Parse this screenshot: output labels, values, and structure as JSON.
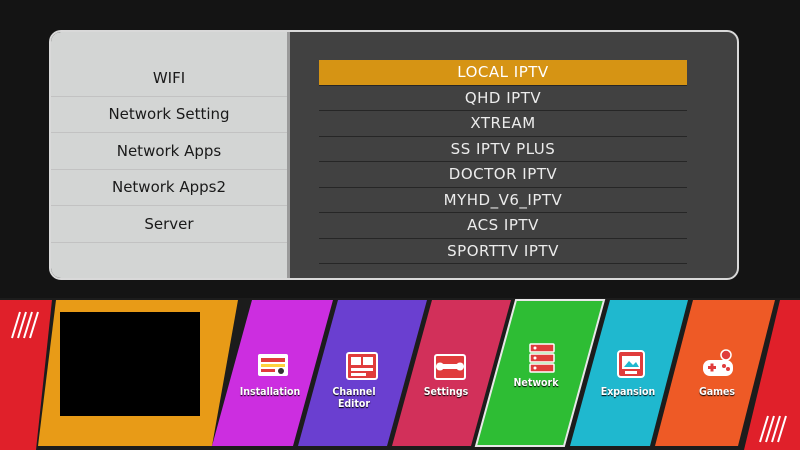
{
  "sidebar": {
    "items": [
      "WIFI",
      "Network Setting",
      "Network Apps",
      "Network Apps2",
      "Server"
    ]
  },
  "iptv_list": {
    "items": [
      "LOCAL IPTV",
      "QHD IPTV",
      "XTREAM",
      "SS IPTV PLUS",
      "DOCTOR IPTV",
      "MYHD_V6_IPTV",
      "ACS IPTV",
      "SPORTTV IPTV"
    ],
    "selected_index": 0
  },
  "taskbar": {
    "items": [
      {
        "label": "Installation",
        "icon": "installation-icon",
        "color": "#cc2ee0"
      },
      {
        "label": "Channel Editor",
        "icon": "channel-editor-icon",
        "color": "#6a3fd0"
      },
      {
        "label": "Settings",
        "icon": "settings-icon",
        "color": "#d2305a"
      },
      {
        "label": "Network",
        "icon": "network-icon",
        "color": "#2ebd34",
        "selected": true
      },
      {
        "label": "Expansion",
        "icon": "expansion-icon",
        "color": "#1fb8cf"
      },
      {
        "label": "Games",
        "icon": "games-icon",
        "color": "#ee5a26"
      }
    ]
  },
  "colors": {
    "selection": "#d69414",
    "sidebar_bg": "#d3d5d4",
    "panel_bg": "#414141",
    "preview_frame": "#e89b17",
    "accent_red": "#e0202a"
  }
}
